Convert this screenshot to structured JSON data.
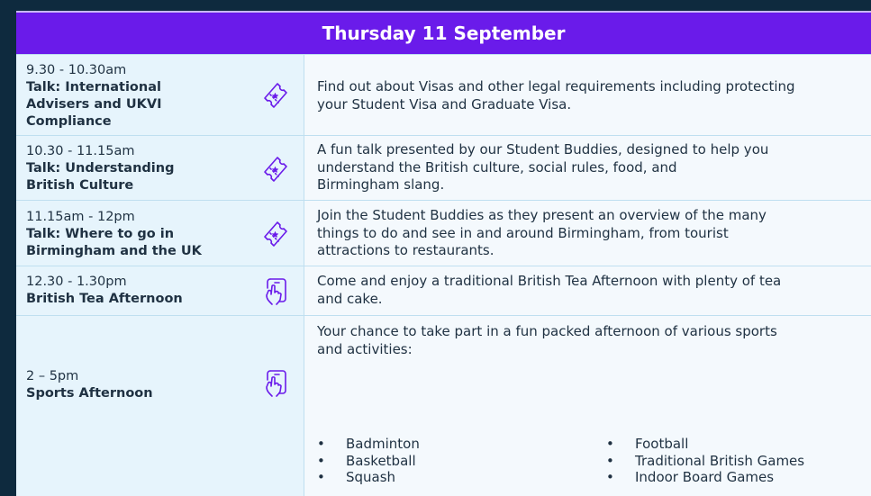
{
  "header": {
    "title": "Thursday 11 September"
  },
  "sessions": [
    {
      "time": "9.30 - 10.30am",
      "title_lines": [
        "Talk: International",
        "Advisers and UKVI",
        "Compliance"
      ],
      "icon": "ticket-icon",
      "description_lines": [
        "Find out about Visas and other legal requirements including protecting",
        "your Student Visa and Graduate Visa."
      ]
    },
    {
      "time": "10.30 - 11.15am",
      "title_lines": [
        "Talk: Understanding",
        "British Culture"
      ],
      "icon": "ticket-icon",
      "description_lines": [
        "A fun talk presented by our Student Buddies, designed to help you",
        "understand the British culture, social rules, food, and",
        "Birmingham slang."
      ]
    },
    {
      "time": "11.15am - 12pm",
      "title_lines": [
        "Talk: Where to go in",
        "Birmingham and the UK"
      ],
      "icon": "ticket-icon",
      "description_lines": [
        "Join the Student Buddies as they present an overview of the many",
        "things to do and see in and around Birmingham, from tourist",
        "attractions to restaurants."
      ]
    },
    {
      "time": "12.30 - 1.30pm",
      "title_lines": [
        "British Tea Afternoon"
      ],
      "icon": "tap-phone-icon",
      "description_lines": [
        "Come and enjoy a traditional British Tea Afternoon with plenty of tea",
        "and cake."
      ]
    },
    {
      "time": "2 – 5pm",
      "title_lines": [
        "Sports Afternoon"
      ],
      "icon": "tap-phone-icon",
      "description_lines": [
        "Your chance to take part in a fun packed afternoon of various sports",
        "and activities:"
      ],
      "activities_left": [
        "Badminton",
        "Basketball",
        "Squash"
      ],
      "activities_right": [
        "Football",
        "Traditional British Games",
        "Indoor Board Games"
      ]
    }
  ],
  "colors": {
    "header_bg": "#6a1bea",
    "left_bg": "#e6f4fc",
    "right_bg": "#f4f9fd",
    "icon_stroke": "#6a1bea",
    "page_bg": "#0e2a3e"
  }
}
